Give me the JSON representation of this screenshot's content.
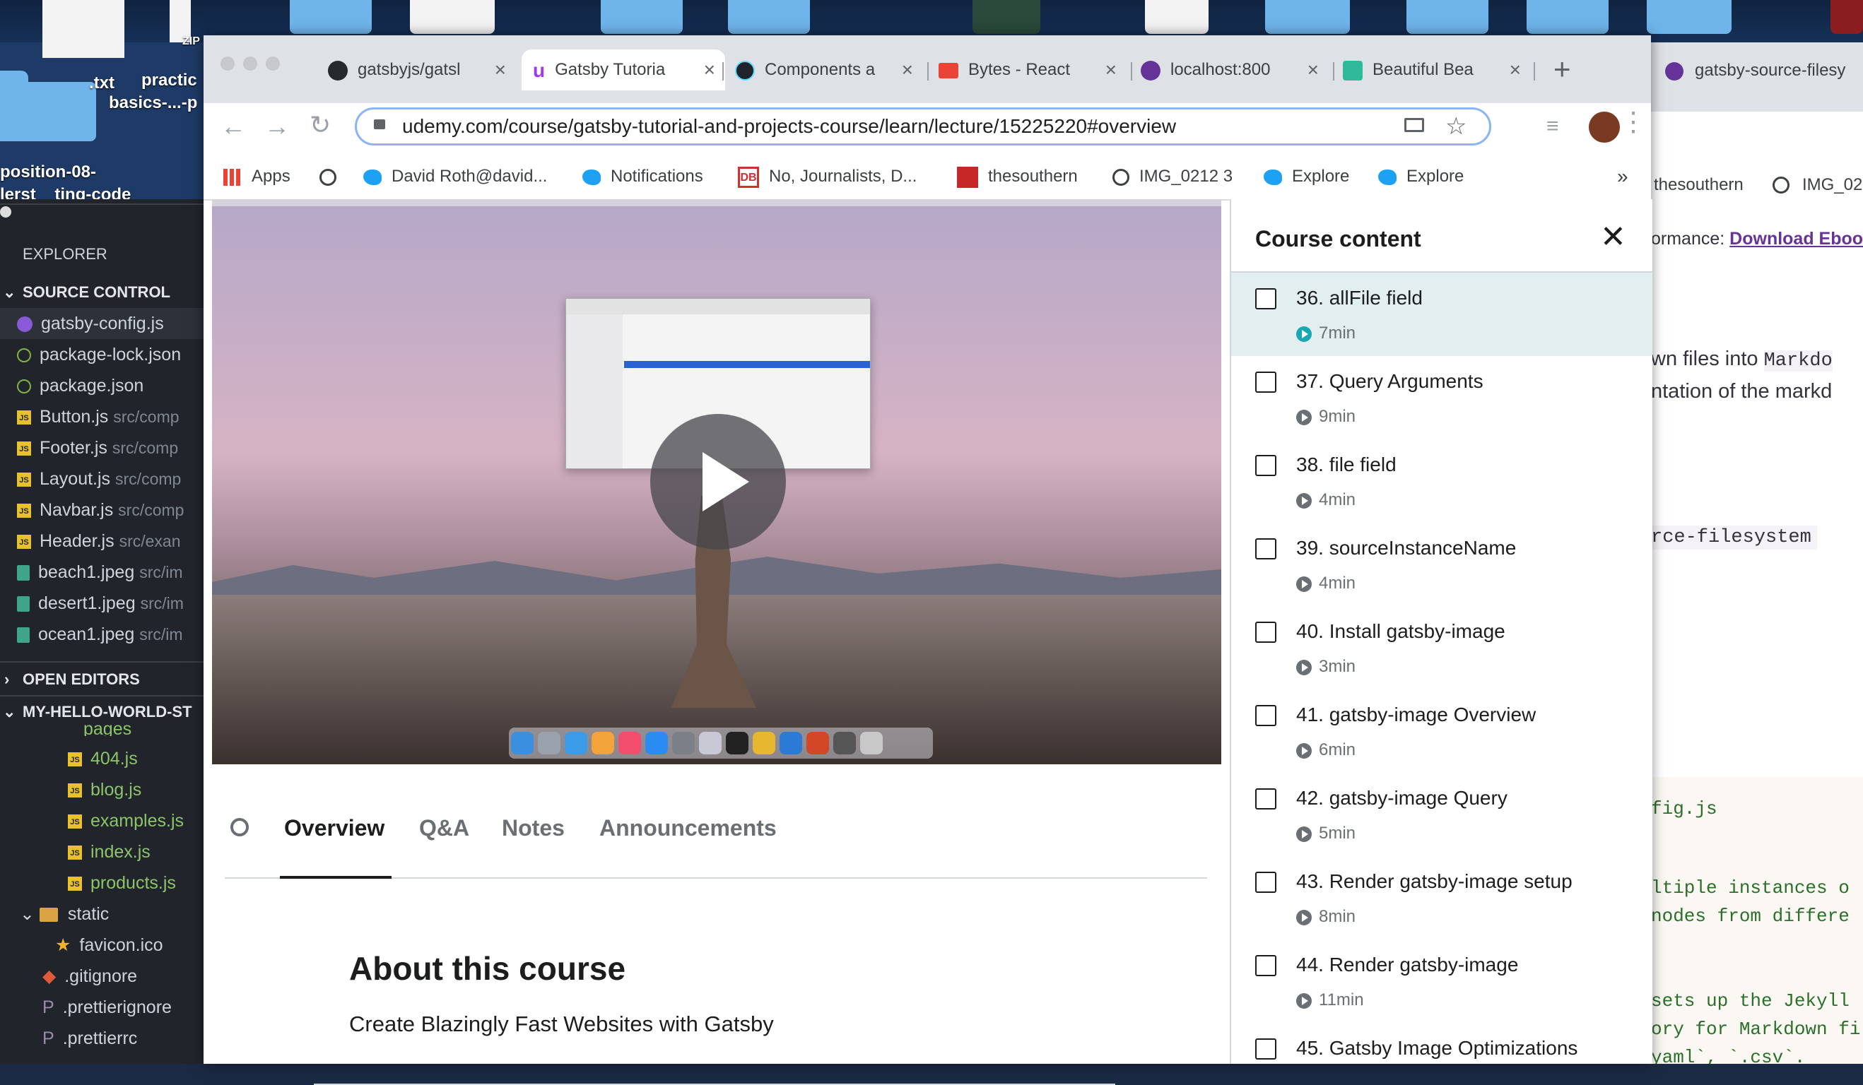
{
  "desktop": {
    "labels": [
      "ZIP",
      ".txt",
      "practic",
      "basics-...-p",
      "position-08-",
      "lerst__ting-code"
    ]
  },
  "vscode": {
    "explorer_label": "EXPLORER",
    "source_control_label": "SOURCE CONTROL",
    "files": [
      {
        "name": "gatsby-config.js",
        "path": ""
      },
      {
        "name": "package-lock.json",
        "path": ""
      },
      {
        "name": "package.json",
        "path": ""
      },
      {
        "name": "Button.js",
        "path": "src/comp"
      },
      {
        "name": "Footer.js",
        "path": "src/comp"
      },
      {
        "name": "Layout.js",
        "path": "src/comp"
      },
      {
        "name": "Navbar.js",
        "path": "src/comp"
      },
      {
        "name": "Header.js",
        "path": "src/exan"
      },
      {
        "name": "beach1.jpeg",
        "path": "src/im"
      },
      {
        "name": "desert1.jpeg",
        "path": "src/im"
      },
      {
        "name": "ocean1.jpeg",
        "path": "src/im"
      }
    ],
    "open_editors_label": "OPEN EDITORS",
    "project_label": "MY-HELLO-WORLD-ST",
    "tree_pages_label": "pages",
    "tree": [
      {
        "name": "404.js"
      },
      {
        "name": "blog.js"
      },
      {
        "name": "examples.js"
      },
      {
        "name": "index.js"
      },
      {
        "name": "products.js"
      }
    ],
    "static_label": "static",
    "favicon": "favicon.ico",
    "gitignore": ".gitignore",
    "prettierignore": ".prettierignore",
    "prettierrc": ".prettierrc"
  },
  "chrome": {
    "tabs": [
      {
        "title": "gatsbyjs/gatsl",
        "icon": "github-icon"
      },
      {
        "title": "Gatsby Tutoria",
        "icon": "udemy-icon",
        "active": true
      },
      {
        "title": "Components a",
        "icon": "react-icon"
      },
      {
        "title": "Bytes - React",
        "icon": "gmail-icon"
      },
      {
        "title": "localhost:800",
        "icon": "gatsby-icon"
      },
      {
        "title": "Beautiful Bea",
        "icon": "b-icon"
      }
    ],
    "new_tab": "+",
    "url_host": "udemy.com",
    "url_path": "/course/gatsby-tutorial-and-projects-course/learn/lecture/15225220#overview",
    "bookmarks": [
      "Apps",
      "David Roth@david...",
      "Notifications",
      "No, Journalists, D...",
      "thesouthern",
      "IMG_0212 3",
      "Explore",
      "Explore"
    ],
    "bookmarks_more": "»"
  },
  "course": {
    "tabs": [
      "Overview",
      "Q&A",
      "Notes",
      "Announcements"
    ],
    "about_title": "About this course",
    "about_subtitle": "Create Blazingly Fast Websites with Gatsby"
  },
  "sidebar": {
    "title": "Course content",
    "items": [
      {
        "title": "36. allFile field",
        "duration": "7min"
      },
      {
        "title": "37. Query Arguments",
        "duration": "9min"
      },
      {
        "title": "38. file field",
        "duration": "4min"
      },
      {
        "title": "39. sourceInstanceName",
        "duration": "4min"
      },
      {
        "title": "40. Install gatsby-image",
        "duration": "3min"
      },
      {
        "title": "41. gatsby-image Overview",
        "duration": "6min"
      },
      {
        "title": "42. gatsby-image Query",
        "duration": "5min"
      },
      {
        "title": "43. Render gatsby-image setup",
        "duration": "8min"
      },
      {
        "title": "44. Render gatsby-image",
        "duration": "11min"
      },
      {
        "title": "45. Gatsby Image Optimizations",
        "duration": ""
      }
    ]
  },
  "rightwin": {
    "tab_title": "gatsby-source-filesy",
    "bookmarks": [
      "thesouthern",
      "IMG_02"
    ],
    "perf_prefix": "ormance:",
    "perf_link": "Download Ebool",
    "text1a": "wn files into ",
    "text1b": "Markdo",
    "text2": "ntation of the markd",
    "code1": "rce-filesystem",
    "code2": "fig.js",
    "code3": "ltiple instances o",
    "code4": " nodes from differe",
    "code5": "sets up the Jekyll",
    "code6": "ory for Markdown fi",
    "code7": "yaml`, `.csv`."
  },
  "colors": {
    "udemy_purple": "#a435f0",
    "accent_blue": "#8ab4f8",
    "current_item_bg": "#e3eef0"
  }
}
